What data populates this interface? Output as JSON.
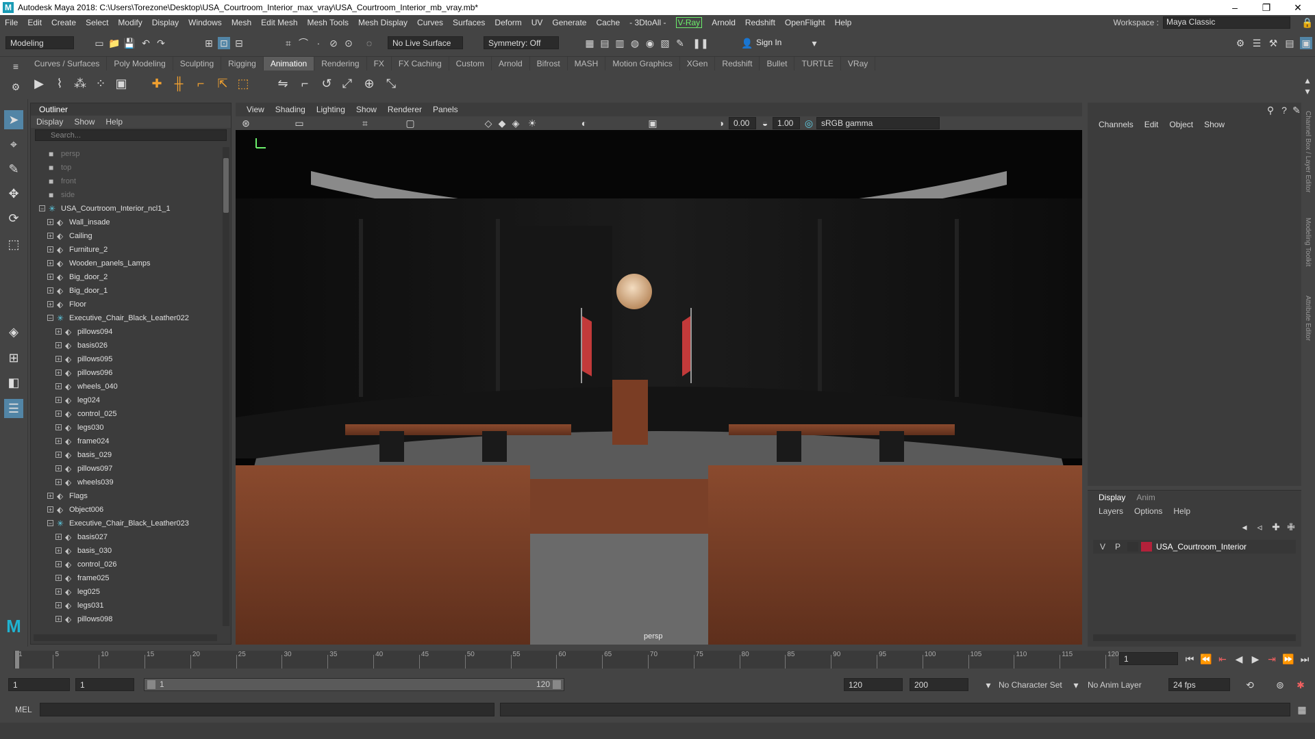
{
  "window": {
    "title": "Autodesk Maya 2018: C:\\Users\\Torezone\\Desktop\\USA_Courtroom_Interior_max_vray\\USA_Courtroom_Interior_mb_vray.mb*",
    "logo": "M",
    "minimize": "–",
    "maximize": "❐",
    "close": "✕"
  },
  "menubar": {
    "items": [
      "File",
      "Edit",
      "Create",
      "Select",
      "Modify",
      "Display",
      "Windows",
      "Mesh",
      "Edit Mesh",
      "Mesh Tools",
      "Mesh Display",
      "Curves",
      "Surfaces",
      "Deform",
      "UV",
      "Generate",
      "Cache",
      "- 3DtoAll -",
      "V-Ray",
      "Arnold",
      "Redshift",
      "OpenFlight",
      "Help"
    ],
    "workspace_label": "Workspace :",
    "workspace_value": "Maya Classic"
  },
  "statusline": {
    "mode": "Modeling",
    "live_surface": "No Live Surface",
    "symmetry": "Symmetry: Off",
    "sign_in": "Sign In"
  },
  "shelf": {
    "tabs": [
      "Curves / Surfaces",
      "Poly Modeling",
      "Sculpting",
      "Rigging",
      "Animation",
      "Rendering",
      "FX",
      "FX Caching",
      "Custom",
      "Arnold",
      "Bifrost",
      "MASH",
      "Motion Graphics",
      "XGen",
      "Redshift",
      "Bullet",
      "TURTLE",
      "VRay"
    ],
    "active_tab": "Animation"
  },
  "outliner": {
    "title": "Outliner",
    "menu": [
      "Display",
      "Show",
      "Help"
    ],
    "search_placeholder": "Search...",
    "rows": [
      {
        "label": "persp",
        "depth": 0,
        "icon": "camera",
        "dim": true
      },
      {
        "label": "top",
        "depth": 0,
        "icon": "camera",
        "dim": true
      },
      {
        "label": "front",
        "depth": 0,
        "icon": "camera",
        "dim": true
      },
      {
        "label": "side",
        "depth": 0,
        "icon": "camera",
        "dim": true
      },
      {
        "label": "USA_Courtroom_Interior_ncl1_1",
        "depth": 0,
        "icon": "group",
        "expanded": true
      },
      {
        "label": "Wall_insade",
        "depth": 1,
        "icon": "mesh",
        "collapsed": true
      },
      {
        "label": "Cailing",
        "depth": 1,
        "icon": "mesh",
        "collapsed": true
      },
      {
        "label": "Furniture_2",
        "depth": 1,
        "icon": "mesh",
        "collapsed": true
      },
      {
        "label": "Wooden_panels_Lamps",
        "depth": 1,
        "icon": "mesh",
        "collapsed": true
      },
      {
        "label": "Big_door_2",
        "depth": 1,
        "icon": "mesh",
        "collapsed": true
      },
      {
        "label": "Big_door_1",
        "depth": 1,
        "icon": "mesh",
        "collapsed": true
      },
      {
        "label": "Floor",
        "depth": 1,
        "icon": "mesh",
        "collapsed": true
      },
      {
        "label": "Executive_Chair_Black_Leather022",
        "depth": 1,
        "icon": "group",
        "expanded": true
      },
      {
        "label": "pillows094",
        "depth": 2,
        "icon": "mesh",
        "collapsed": true
      },
      {
        "label": "basis026",
        "depth": 2,
        "icon": "mesh",
        "collapsed": true
      },
      {
        "label": "pillows095",
        "depth": 2,
        "icon": "mesh",
        "collapsed": true
      },
      {
        "label": "pillows096",
        "depth": 2,
        "icon": "mesh",
        "collapsed": true
      },
      {
        "label": "wheels_040",
        "depth": 2,
        "icon": "mesh",
        "collapsed": true
      },
      {
        "label": "leg024",
        "depth": 2,
        "icon": "mesh",
        "collapsed": true
      },
      {
        "label": "control_025",
        "depth": 2,
        "icon": "mesh",
        "collapsed": true
      },
      {
        "label": "legs030",
        "depth": 2,
        "icon": "mesh",
        "collapsed": true
      },
      {
        "label": "frame024",
        "depth": 2,
        "icon": "mesh",
        "collapsed": true
      },
      {
        "label": "basis_029",
        "depth": 2,
        "icon": "mesh",
        "collapsed": true
      },
      {
        "label": "pillows097",
        "depth": 2,
        "icon": "mesh",
        "collapsed": true
      },
      {
        "label": "wheels039",
        "depth": 2,
        "icon": "mesh",
        "collapsed": true
      },
      {
        "label": "Flags",
        "depth": 1,
        "icon": "mesh",
        "collapsed": true
      },
      {
        "label": "Object006",
        "depth": 1,
        "icon": "mesh",
        "collapsed": true
      },
      {
        "label": "Executive_Chair_Black_Leather023",
        "depth": 1,
        "icon": "group",
        "expanded": true
      },
      {
        "label": "basis027",
        "depth": 2,
        "icon": "mesh",
        "collapsed": true
      },
      {
        "label": "basis_030",
        "depth": 2,
        "icon": "mesh",
        "collapsed": true
      },
      {
        "label": "control_026",
        "depth": 2,
        "icon": "mesh",
        "collapsed": true
      },
      {
        "label": "frame025",
        "depth": 2,
        "icon": "mesh",
        "collapsed": true
      },
      {
        "label": "leg025",
        "depth": 2,
        "icon": "mesh",
        "collapsed": true
      },
      {
        "label": "legs031",
        "depth": 2,
        "icon": "mesh",
        "collapsed": true
      },
      {
        "label": "pillows098",
        "depth": 2,
        "icon": "mesh",
        "collapsed": true
      }
    ]
  },
  "viewport": {
    "menu": [
      "View",
      "Shading",
      "Lighting",
      "Show",
      "Renderer",
      "Panels"
    ],
    "exposure": "0.00",
    "gamma": "1.00",
    "color_space": "sRGB gamma",
    "camera_label": "persp"
  },
  "channelbox": {
    "menu": [
      "Channels",
      "Edit",
      "Object",
      "Show"
    ]
  },
  "layers": {
    "tabs": [
      "Display",
      "Anim"
    ],
    "active_tab": "Display",
    "menu": [
      "Layers",
      "Options",
      "Help"
    ],
    "layer": {
      "v": "V",
      "p": "P",
      "name": "USA_Courtroom_Interior",
      "color": "#b3213a"
    }
  },
  "rightstrip": {
    "labels": [
      "Channel Box / Layer Editor",
      "Modeling Toolkit",
      "Attribute Editor"
    ]
  },
  "timeslider": {
    "ticks": [
      1,
      5,
      10,
      15,
      20,
      25,
      30,
      35,
      40,
      45,
      50,
      55,
      60,
      65,
      70,
      75,
      80,
      85,
      90,
      95,
      100,
      105,
      110,
      115,
      120
    ],
    "range_end": 120,
    "current_frame": "1"
  },
  "rangebar": {
    "start": "1",
    "playback_start": "1",
    "slider_start": "1",
    "slider_end": "120",
    "playback_end": "120",
    "end": "200",
    "character_set": "No Character Set",
    "anim_layer": "No Anim Layer",
    "fps": "24 fps"
  },
  "cmdline": {
    "label": "MEL"
  }
}
